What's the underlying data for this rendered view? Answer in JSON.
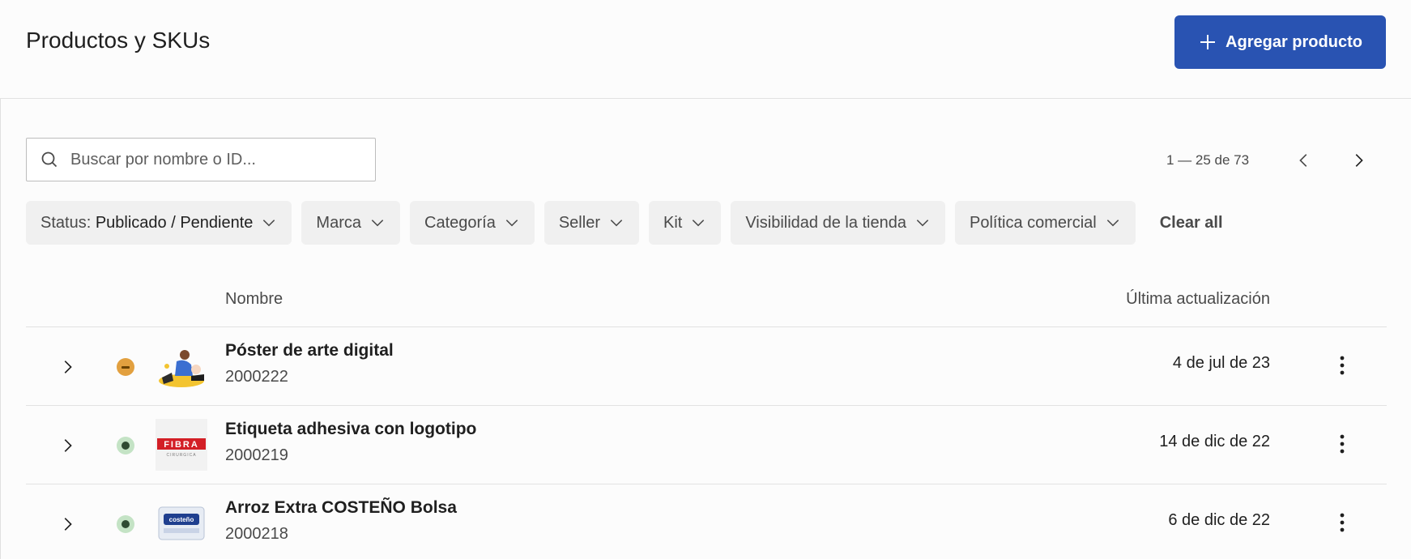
{
  "header": {
    "title": "Productos y SKUs",
    "add_button_label": "Agregar producto"
  },
  "search": {
    "placeholder": "Buscar por nombre o ID..."
  },
  "pagination": {
    "info": "1 — 25 de 73"
  },
  "filters": {
    "status_label": "Status:",
    "status_value": "Publicado / Pendiente",
    "chips": [
      "Marca",
      "Categoría",
      "Seller",
      "Kit",
      "Visibilidad de la tienda",
      "Política comercial"
    ],
    "clear_all": "Clear all"
  },
  "table": {
    "columns": {
      "name": "Nombre",
      "updated": "Última actualización"
    },
    "rows": [
      {
        "name": "Póster de arte digital",
        "id": "2000222",
        "updated": "4 de jul de 23",
        "status": "pending",
        "thumb": "poster-art"
      },
      {
        "name": "Etiqueta adhesiva con logotipo",
        "id": "2000219",
        "updated": "14 de dic de 22",
        "status": "published",
        "thumb": "fibra-logo",
        "thumb_text": "FIBRA",
        "thumb_subtext": "CIRURGICA"
      },
      {
        "name": "Arroz Extra COSTEÑO Bolsa",
        "id": "2000218",
        "updated": "6 de dic de 22",
        "status": "published",
        "thumb": "costeno-bag",
        "thumb_text": "costeño"
      }
    ]
  },
  "colors": {
    "primary": "#2953b2",
    "pending": "#e2a03f",
    "published": "#c4e3c5"
  }
}
